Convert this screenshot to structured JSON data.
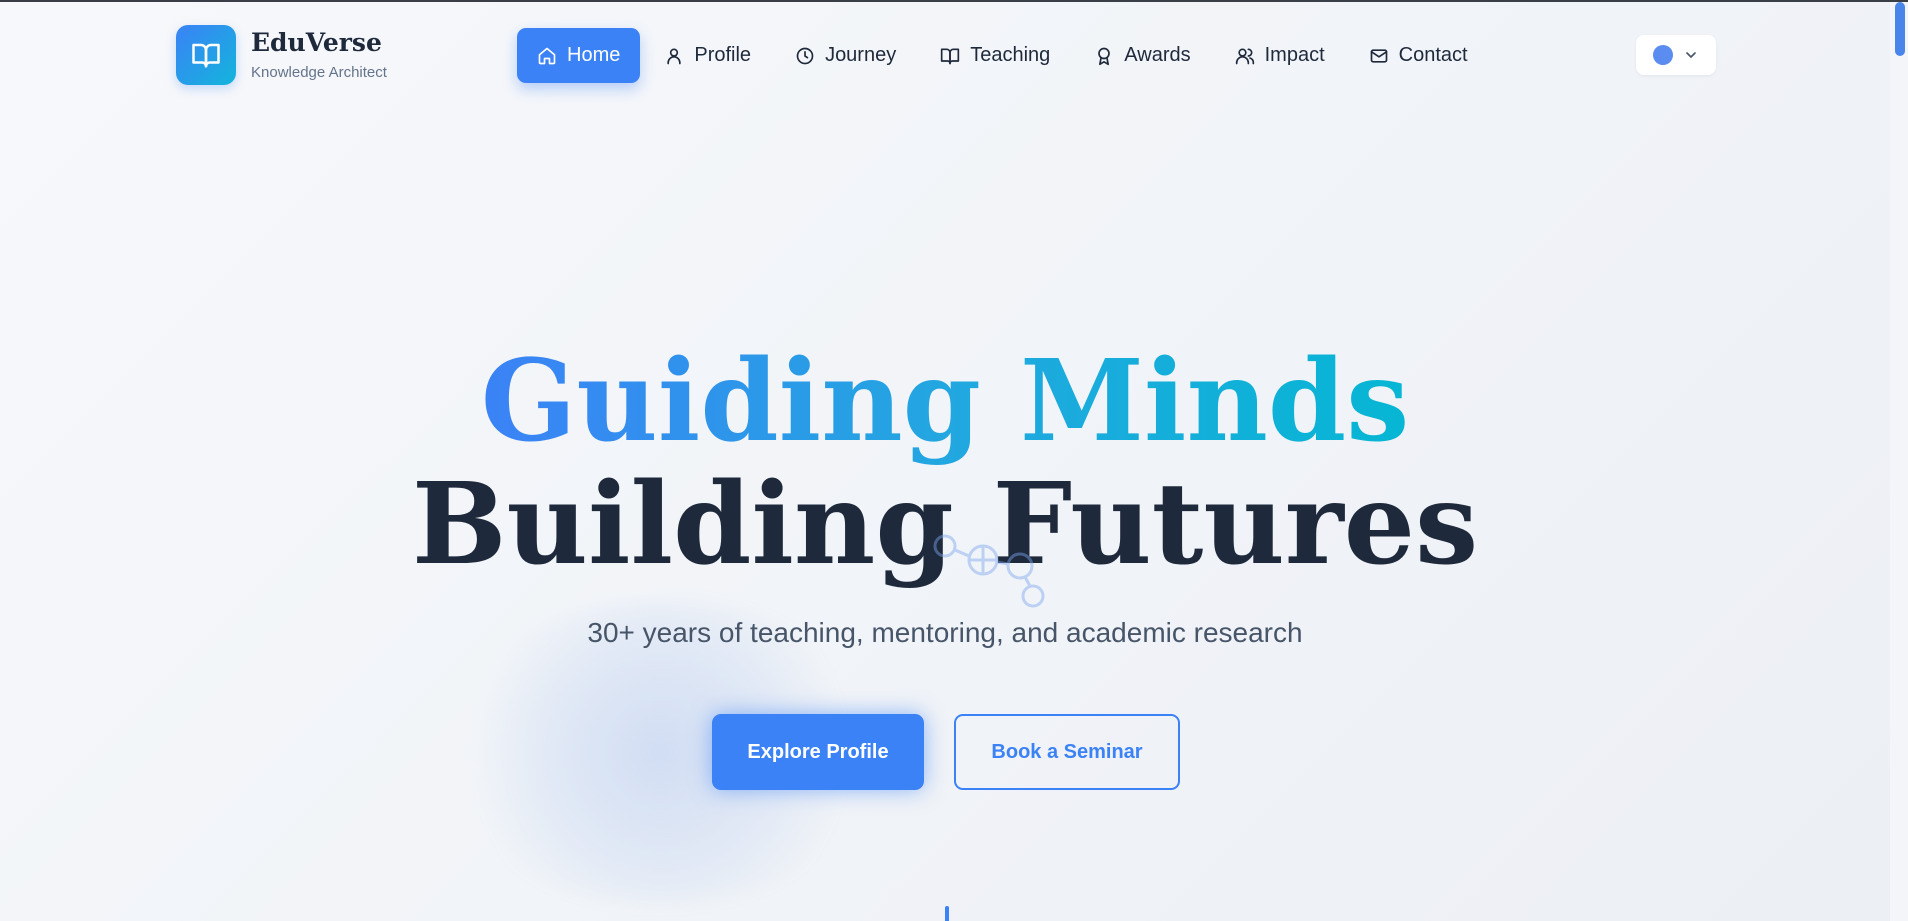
{
  "brand": {
    "name": "EduVerse",
    "tagline": "Knowledge Architect"
  },
  "nav": {
    "items": [
      {
        "label": "Home",
        "icon": "home-icon",
        "active": true
      },
      {
        "label": "Profile",
        "icon": "user-icon",
        "active": false
      },
      {
        "label": "Journey",
        "icon": "clock-icon",
        "active": false
      },
      {
        "label": "Teaching",
        "icon": "book-open-icon",
        "active": false
      },
      {
        "label": "Awards",
        "icon": "award-icon",
        "active": false
      },
      {
        "label": "Impact",
        "icon": "users-icon",
        "active": false
      },
      {
        "label": "Contact",
        "icon": "mail-icon",
        "active": false
      }
    ]
  },
  "hero": {
    "title_line1": "Guiding Minds",
    "title_line2": "Building Futures",
    "subtitle": "30+ years of teaching, mentoring, and academic research",
    "primary_cta": "Explore Profile",
    "secondary_cta": "Book a Seminar"
  },
  "colors": {
    "accent": "#3b82f6",
    "accent_secondary": "#06b6d4",
    "heading": "#1e293b",
    "muted": "#64748b"
  }
}
